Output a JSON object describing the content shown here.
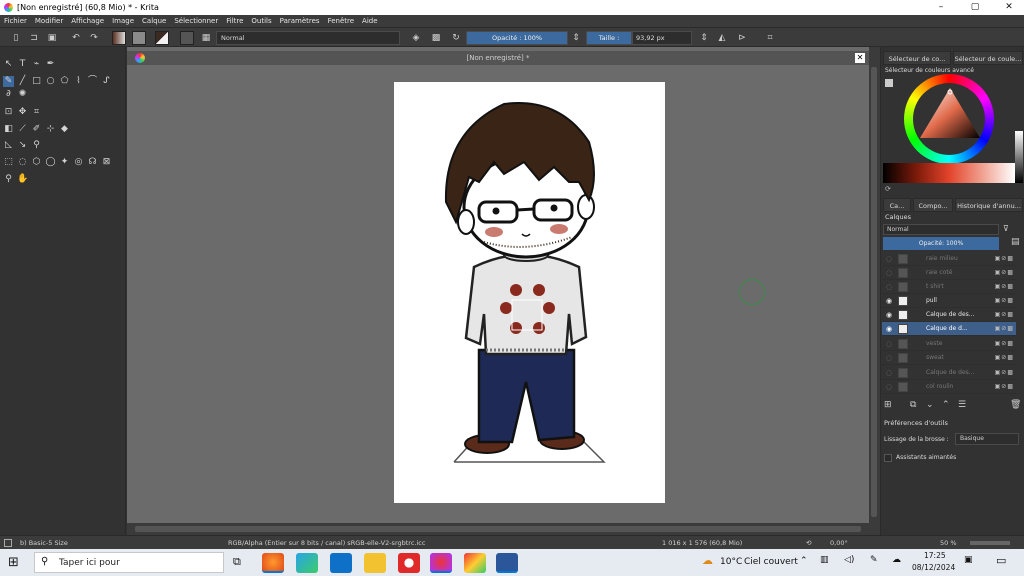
{
  "window": {
    "title": "[Non enregistré]  (60,8 Mio)  * - Krita",
    "controls": [
      "–",
      "▢",
      "✕"
    ]
  },
  "menu": [
    "Fichier",
    "Modifier",
    "Affichage",
    "Image",
    "Calque",
    "Sélectionner",
    "Filtre",
    "Outils",
    "Paramètres",
    "Fenêtre",
    "Aide"
  ],
  "toolbar": {
    "blend_mode": "Normal",
    "opacity_label": "Opacité : 100%",
    "size_label": "Taille :",
    "size_value": "93,92 px"
  },
  "canvas": {
    "tab_title": "[Non enregistré]  *",
    "close": "✕"
  },
  "right_panel": {
    "top_tabs": [
      "Sélecteur de co...",
      "Sélecteur de coule..."
    ],
    "color_selector_title": "Sélecteur de couleurs avancé",
    "mid_tabs": [
      "Ca...",
      "Compo...",
      "Historique d'annu..."
    ],
    "layers_title": "Calques",
    "layer_blend": "Normal",
    "layer_opacity": "Opacité:  100%",
    "layers": [
      {
        "name": "raie milieu",
        "visible": false,
        "selected": false
      },
      {
        "name": "raie coté",
        "visible": false,
        "selected": false
      },
      {
        "name": "t shirt",
        "visible": false,
        "selected": false
      },
      {
        "name": "pull",
        "visible": true,
        "selected": false
      },
      {
        "name": "Calque de des...",
        "visible": true,
        "selected": false
      },
      {
        "name": "Calque de d...",
        "visible": true,
        "selected": true
      },
      {
        "name": "veste",
        "visible": false,
        "selected": false
      },
      {
        "name": "sweat",
        "visible": false,
        "selected": false
      },
      {
        "name": "Calque de des...",
        "visible": false,
        "selected": false
      },
      {
        "name": "col roulin",
        "visible": false,
        "selected": false
      }
    ],
    "tool_prefs_title": "Préférences d'outils",
    "smoothing_label": "Lissage de la brosse :",
    "smoothing_value": "Basique",
    "magnetic_label": "Assistants aimantés"
  },
  "status": {
    "brush": "b) Basic-5 Size",
    "color_space": "RGB/Alpha (Entier sur 8 bits / canal)  sRGB-elle-V2-srgbtrc.icc",
    "dimensions": "1 016 x 1 576 (60,8 Mio)",
    "rotation": "0,00°",
    "zoom": "50 %"
  },
  "taskbar": {
    "search_placeholder": "Taper ici pour",
    "weather_temp": "10°C",
    "weather_desc": "Ciel couvert",
    "time": "17:25",
    "date": "08/12/2024"
  },
  "colors": {
    "accent": "#3d6a9e",
    "selected_layer": "#3e5f8a",
    "canvas_bg": "#6b6b6b"
  }
}
